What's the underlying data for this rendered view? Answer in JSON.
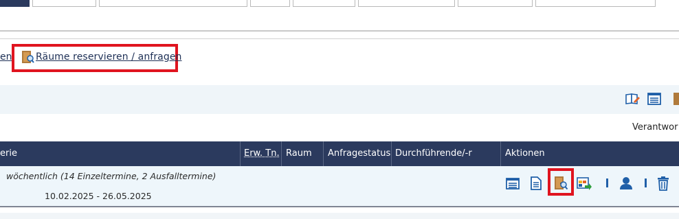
{
  "links": {
    "previous_link_tail": "en",
    "reserve_rooms": "Räume reservieren / anfragen"
  },
  "header": {
    "responsible_label": "Verantwor"
  },
  "table": {
    "columns": {
      "series": "erie",
      "expected_participants": "Erw. Tn.",
      "room": "Raum",
      "request_status": "Anfragestatus",
      "instructor": "Durchführende/-r",
      "actions": "Aktionen"
    },
    "row": {
      "interval": "wöchentlich (14 Einzeltermine, 2 Ausfalltermine)",
      "date_range": "10.02.2025 - 26.05.2025"
    }
  },
  "icons": {
    "toolbar": [
      "book-edit-icon",
      "list-view-icon",
      "door-icon"
    ],
    "actions": [
      "list-icon",
      "document-icon",
      "room-request-icon",
      "export-icon",
      "person-icon",
      "trash-icon"
    ]
  },
  "colors": {
    "header_bg": "#2b3a5e",
    "row_bg": "#eef6fb",
    "highlight": "#e0141f",
    "link": "#1d2f55",
    "icon_blue": "#1f5fa8"
  }
}
